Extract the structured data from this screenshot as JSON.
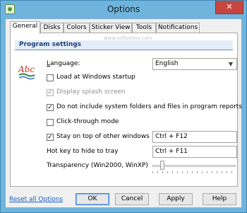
{
  "window": {
    "title": "Options",
    "close_glyph": "✕"
  },
  "tabs": [
    {
      "label": "General",
      "active": true
    },
    {
      "label": "Disks",
      "active": false
    },
    {
      "label": "Colors",
      "active": false
    },
    {
      "label": "Sticker View",
      "active": false
    },
    {
      "label": "Tools",
      "active": false
    },
    {
      "label": "Notifications",
      "active": false
    }
  ],
  "watermark": "www.softpedia.com",
  "section": {
    "title": "Program settings"
  },
  "language": {
    "label_mnemonic": "L",
    "label_rest": "anguage:",
    "value": "English",
    "icon_text": "Abc"
  },
  "options": [
    {
      "label": "Load at Windows startup",
      "checked": false,
      "enabled": true
    },
    {
      "label": "Display splash screen",
      "checked": true,
      "enabled": false
    },
    {
      "label": "Do not include system folders and files in program reports",
      "checked": true,
      "enabled": true
    },
    {
      "label": "Click-through mode",
      "checked": false,
      "enabled": true
    },
    {
      "label": "Stay on top of other windows",
      "checked": true,
      "enabled": true
    }
  ],
  "stay_on_top_hotkey": "Ctrl + F12",
  "hide_tray": {
    "label": "Hot key to hide to tray",
    "value": "Ctrl + F11"
  },
  "transparency": {
    "label": "Transparency (Win2000, WinXP)",
    "level": 0.1
  },
  "footer": {
    "reset_label": "Reset all Options",
    "ok": "OK",
    "cancel": "Cancel",
    "apply": "Apply",
    "help": "Help"
  },
  "colors": {
    "titlebar": "#6fb4dd",
    "close": "#c7463f",
    "section_header_text": "#1c3f78",
    "link": "#1a5cc4"
  }
}
